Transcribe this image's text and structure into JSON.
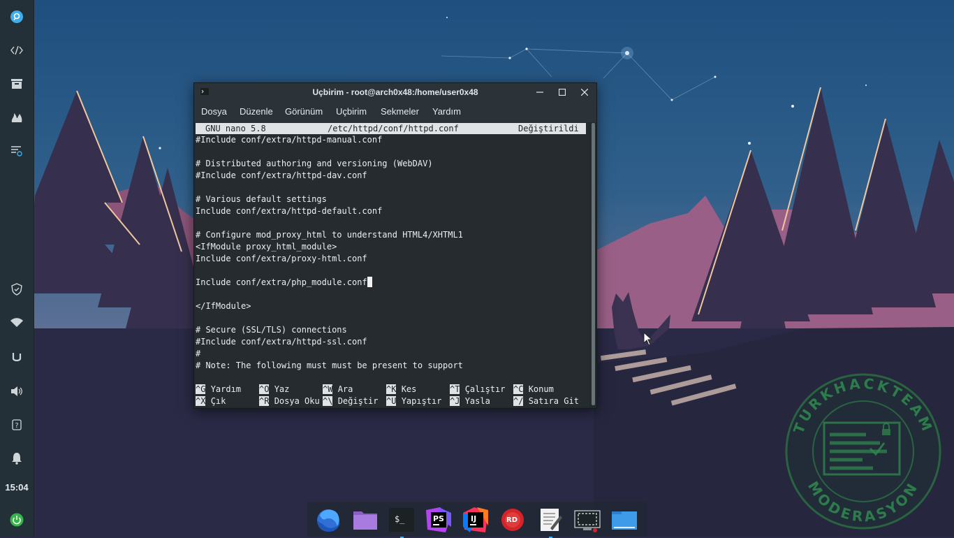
{
  "window": {
    "title": "Uçbirim - root@arch0x48:/home/user0x48",
    "menu": [
      "Dosya",
      "Düzenle",
      "Görünüm",
      "Uçbirim",
      "Sekmeler",
      "Yardım"
    ]
  },
  "nano": {
    "version": "GNU nano 5.8",
    "file": "/etc/httpd/conf/httpd.conf",
    "status": "Değiştirildi",
    "lines": [
      "#Include conf/extra/httpd-manual.conf",
      "",
      "# Distributed authoring and versioning (WebDAV)",
      "#Include conf/extra/httpd-dav.conf",
      "",
      "# Various default settings",
      "Include conf/extra/httpd-default.conf",
      "",
      "# Configure mod_proxy_html to understand HTML4/XHTML1",
      "<IfModule proxy_html_module>",
      "Include conf/extra/proxy-html.conf",
      "",
      "Include conf/extra/php_module.conf",
      "",
      "</IfModule>",
      "",
      "# Secure (SSL/TLS) connections",
      "#Include conf/extra/httpd-ssl.conf",
      "#",
      "# Note: The following must must be present to support"
    ],
    "shortcuts_row1": [
      {
        "key": "^G",
        "label": "Yardım"
      },
      {
        "key": "^O",
        "label": "Yaz"
      },
      {
        "key": "^W",
        "label": "Ara"
      },
      {
        "key": "^K",
        "label": "Kes"
      },
      {
        "key": "^T",
        "label": "Çalıştır"
      },
      {
        "key": "^C",
        "label": "Konum"
      }
    ],
    "shortcuts_row2": [
      {
        "key": "^X",
        "label": "Çık"
      },
      {
        "key": "^R",
        "label": "Dosya Oku"
      },
      {
        "key": "^\\",
        "label": "Değiştir"
      },
      {
        "key": "^U",
        "label": "Yapıştır"
      },
      {
        "key": "^J",
        "label": "Yasla"
      },
      {
        "key": "^/",
        "label": "Satıra Git"
      }
    ]
  },
  "panel": {
    "clock": "15:04",
    "icons": [
      "search-icon",
      "code-icon",
      "archive-icon",
      "fire-icon",
      "list-search-icon",
      "shield-icon",
      "wifi-icon",
      "u-icon",
      "volume-icon",
      "help-icon",
      "bell-icon",
      "power-icon"
    ]
  },
  "dock": {
    "apps": [
      "firefox",
      "files",
      "terminal",
      "phpstorm",
      "intellij",
      "rider",
      "text-editor",
      "screenshot",
      "file-manager"
    ],
    "labels": {
      "phpstorm": "PS",
      "intellij": "IJ",
      "rider": "RD",
      "terminal": "$_"
    }
  },
  "watermark": {
    "top": "TURKHACKTEAM",
    "bottom": "MODERASYON"
  },
  "colors": {
    "panel": "#243038",
    "terminal_bg": "#252c30",
    "accent": "#3daee9",
    "watermark": "#1f6b3a"
  }
}
